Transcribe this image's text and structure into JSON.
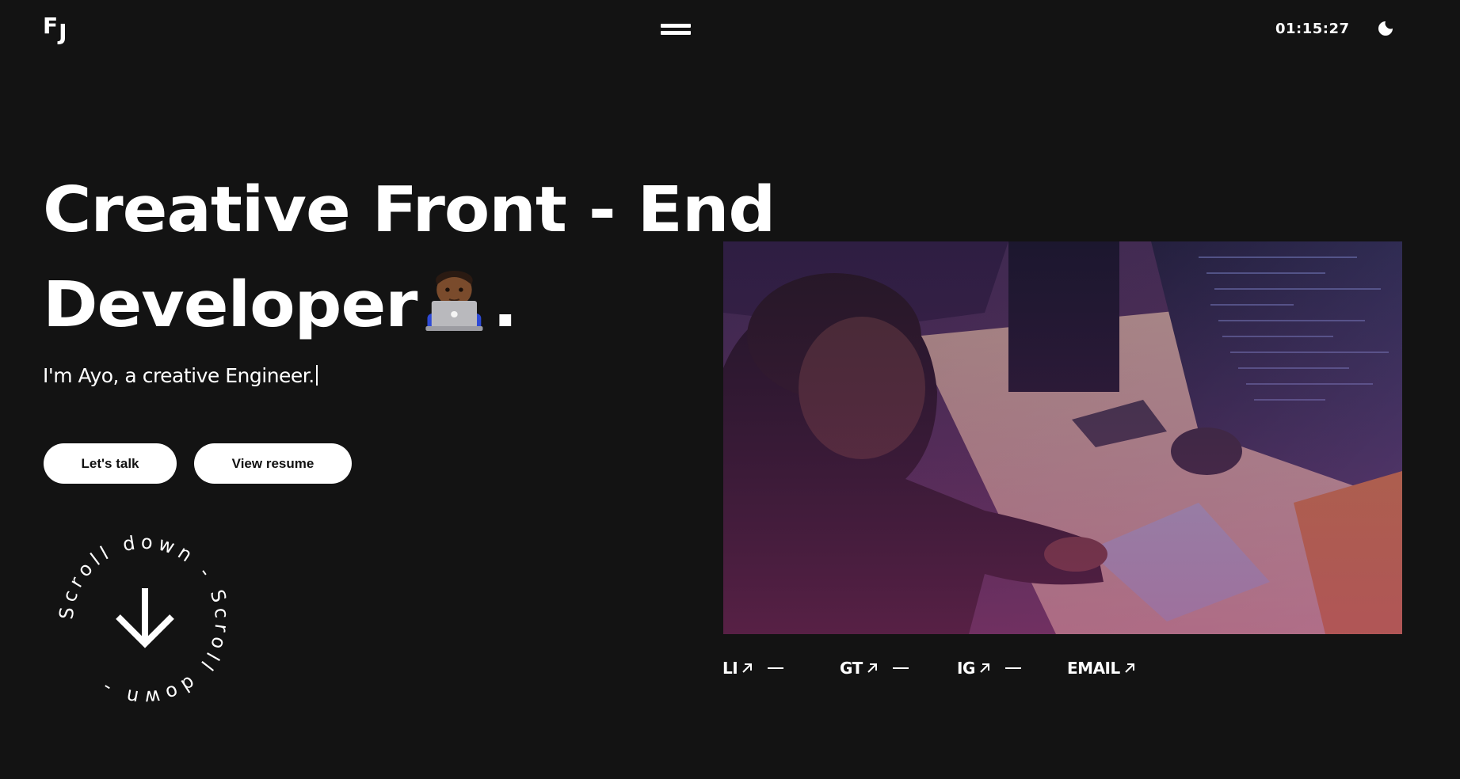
{
  "header": {
    "logo": {
      "first": "F",
      "second": "J"
    },
    "menu_icon": "hamburger-icon",
    "clock": "01:15:27",
    "theme_icon": "moon-icon"
  },
  "hero": {
    "title_line1": "Creative Front - End",
    "title_line2": "Developer",
    "title_emoji": "technologist-emoji",
    "title_end": ".",
    "subtitle": "I'm Ayo, a creative Engineer."
  },
  "actions": {
    "talk_label": "Let's talk",
    "resume_label": "View resume"
  },
  "scroll_indicator": {
    "text": "Scroll down - Scroll down - ",
    "icon": "arrow-down-icon"
  },
  "photo": {
    "icon": "developer-photo"
  },
  "socials": [
    {
      "label": "LI",
      "icon": "arrow-up-right-icon"
    },
    {
      "label": "GT",
      "icon": "arrow-up-right-icon"
    },
    {
      "label": "IG",
      "icon": "arrow-up-right-icon"
    },
    {
      "label": "EMAIL",
      "icon": "arrow-up-right-icon"
    }
  ],
  "colors": {
    "background": "#131313",
    "foreground": "#ffffff",
    "button_bg": "#ffffff",
    "button_text": "#111111"
  }
}
